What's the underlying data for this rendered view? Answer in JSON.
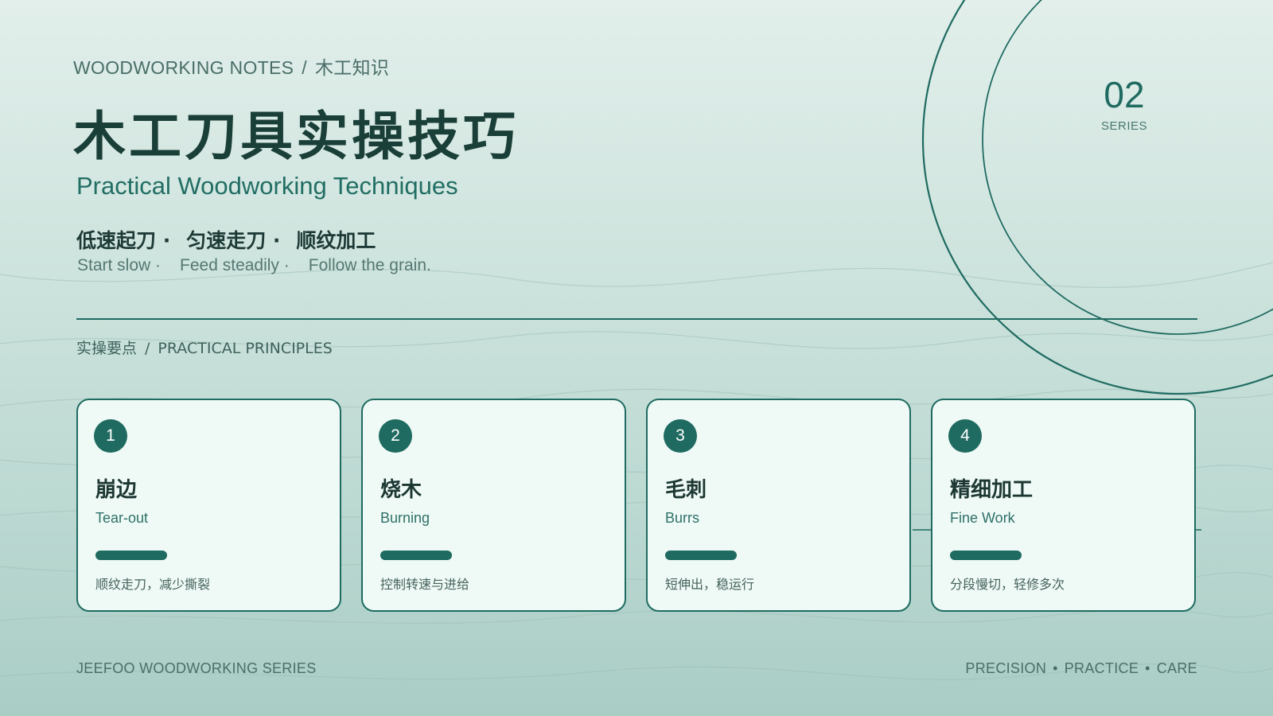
{
  "header": {
    "kicker_en": "WOODWORKING NOTES",
    "kicker_sep": "/",
    "kicker_cn": "木工知识",
    "title": "木工刀具实操技巧",
    "subtitle": "Practical Woodworking Techniques"
  },
  "motto": {
    "cn": [
      "低速起刀 ·",
      "匀速走刀 ·",
      "顺纹加工"
    ],
    "en": [
      "Start slow ·",
      "Feed steadily ·",
      "Follow the grain."
    ]
  },
  "series": {
    "number": "02",
    "label": "SERIES"
  },
  "section": {
    "cn": "实操要点",
    "sep": "/",
    "en": "PRACTICAL PRINCIPLES"
  },
  "cards": [
    {
      "number": "1",
      "title_cn": "崩边",
      "title_en": "Tear-out",
      "desc": "顺纹走刀，减少撕裂"
    },
    {
      "number": "2",
      "title_cn": "烧木",
      "title_en": "Burning",
      "desc": "控制转速与进给"
    },
    {
      "number": "3",
      "title_cn": "毛刺",
      "title_en": "Burrs",
      "desc": "短伸出，稳运行"
    },
    {
      "number": "4",
      "title_cn": "精细加工",
      "title_en": "Fine Work",
      "desc": "分段慢切，轻修多次"
    }
  ],
  "footer": {
    "left": "JEEFOO WOODWORKING SERIES",
    "right": [
      "PRECISION",
      "PRACTICE",
      "CARE"
    ],
    "bullet": "•"
  },
  "colors": {
    "accent": "#1f6b61",
    "title": "#1a3f39",
    "card_bg": "#effaf6",
    "background_top": "#e2efeb",
    "background_bottom": "#a9cdc5"
  }
}
